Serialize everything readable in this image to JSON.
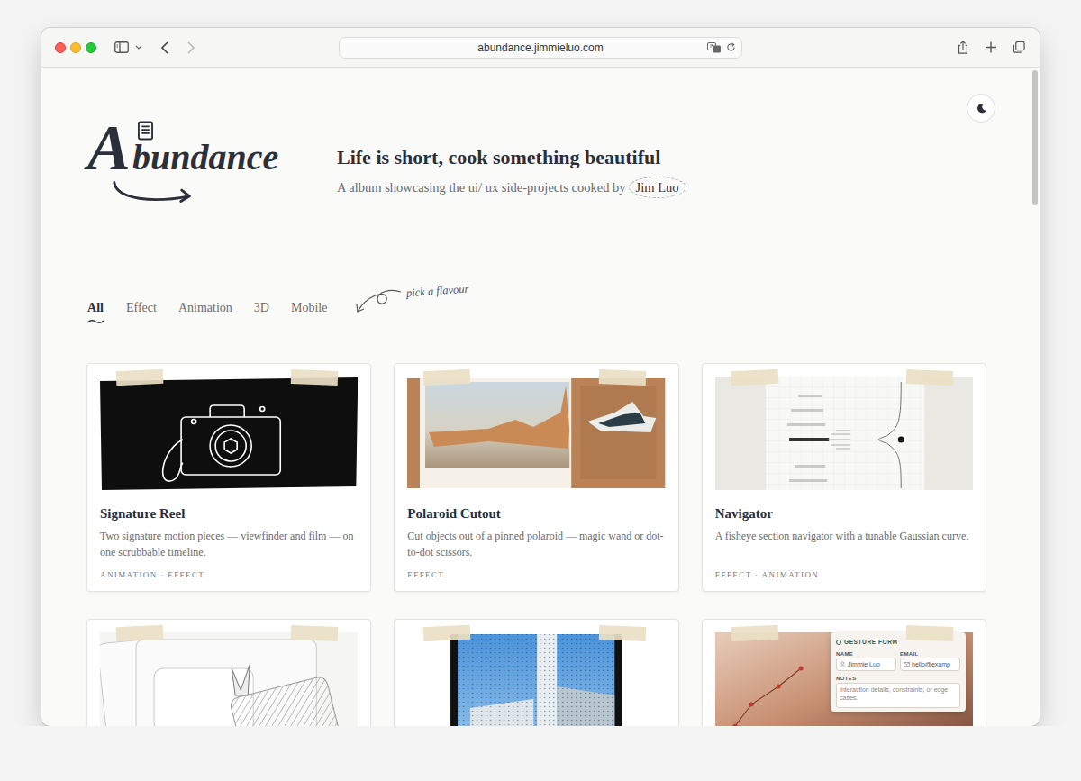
{
  "browser": {
    "url": "abundance.jimmieluo.com",
    "can_go_back": true,
    "can_go_forward": false
  },
  "logo": {
    "initial": "A",
    "rest": "bundance"
  },
  "hero": {
    "title": "Life is short, cook something beautiful",
    "subtitle": "A album showcasing the ui/ ux side-projects cooked by",
    "author": "Jim Luo"
  },
  "theme_toggle": {
    "dark": false
  },
  "tabs": [
    {
      "label": "All",
      "selected": true
    },
    {
      "label": "Effect",
      "selected": false
    },
    {
      "label": "Animation",
      "selected": false
    },
    {
      "label": "3D",
      "selected": false
    },
    {
      "label": "Mobile",
      "selected": false
    }
  ],
  "tabs_note": "pick a flavour",
  "cards": [
    {
      "kind": "camera",
      "title": "Signature Reel",
      "description": "Two signature motion pieces — viewfinder and film — on one scrubbable timeline.",
      "tags": "ANIMATION · EFFECT"
    },
    {
      "kind": "polaroid",
      "title": "Polaroid Cutout",
      "description": "Cut objects out of a pinned polaroid — magic wand or dot-to-dot scissors.",
      "tags": "EFFECT"
    },
    {
      "kind": "navigator",
      "title": "Navigator",
      "description": "A fisheye section navigator with a tunable Gaussian curve.",
      "tags": "EFFECT · ANIMATION"
    },
    {
      "kind": "sketch"
    },
    {
      "kind": "building"
    },
    {
      "kind": "gesture",
      "form": {
        "title": "GESTURE FORM",
        "fields": [
          {
            "label": "NAME",
            "value": "Jimmie Luo",
            "kind": "person"
          },
          {
            "label": "EMAIL",
            "value": "hello@examp",
            "kind": "email"
          }
        ],
        "notes_label": "NOTES",
        "notes_placeholder": "Interaction details, constraints, or edge cases."
      }
    }
  ]
}
